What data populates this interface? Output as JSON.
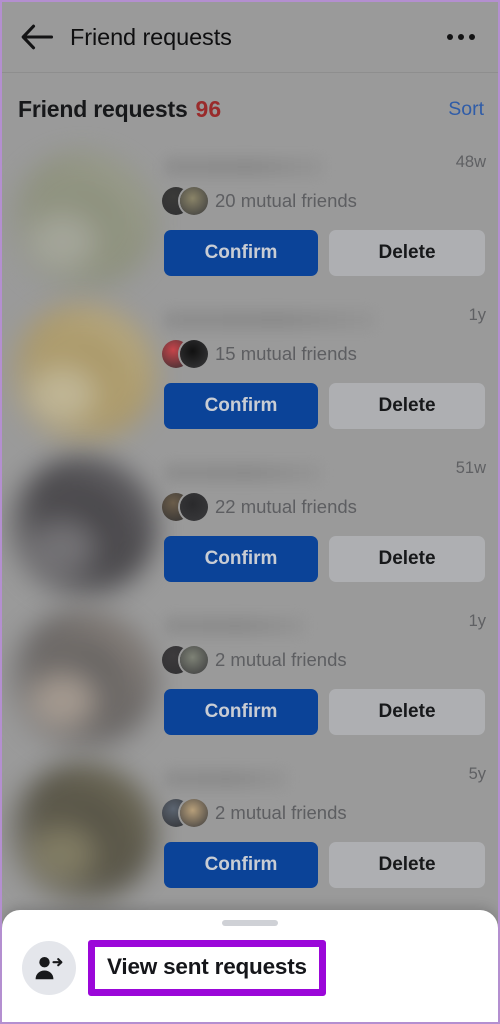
{
  "appbar": {
    "back_icon": "arrow-left-icon",
    "title": "Friend requests",
    "overflow_icon": "more-horizontal-icon"
  },
  "section": {
    "title": "Friend requests",
    "count": "96",
    "count_color": "#992b2b",
    "sort_label": "Sort",
    "sort_color": "#2f5ca8"
  },
  "colors": {
    "scrim": "#9a9a9a",
    "confirm_button": "#0b4398",
    "delete_button": "#aeafb2",
    "highlight": "#9b07d9",
    "sheet_background": "#ffffff",
    "icon_circle": "#e4e6eb",
    "frame_border": "#b48fd0"
  },
  "requests": [
    {
      "name": "",
      "name_blurred": true,
      "name_blur_width": 160,
      "age": "48w",
      "mutual": "20 mutual friends",
      "mutual_count": 20,
      "confirm_label": "Confirm",
      "delete_label": "Delete",
      "avatar_blurred": true,
      "avatar_tone_a": "#8c9078",
      "avatar_tone_b": "#a6a89a",
      "mutual_avatar_a": "#3a3a38",
      "mutual_avatar_b": "#8a8468"
    },
    {
      "name": "",
      "name_blurred": true,
      "name_blur_width": 212,
      "age": "1y",
      "mutual": "15 mutual friends",
      "mutual_count": 15,
      "confirm_label": "Confirm",
      "delete_label": "Delete",
      "avatar_blurred": true,
      "avatar_tone_a": "#b09a60",
      "avatar_tone_b": "#c8bc95",
      "mutual_avatar_a": "#c6444a",
      "mutual_avatar_b": "#111111"
    },
    {
      "name": "",
      "name_blurred": true,
      "name_blur_width": 158,
      "age": "51w",
      "mutual": "22 mutual friends",
      "mutual_count": 22,
      "confirm_label": "Confirm",
      "delete_label": "Delete",
      "avatar_blurred": true,
      "avatar_tone_a": "#38363a",
      "avatar_tone_b": "#6c6a6e",
      "mutual_avatar_a": "#6b5d4a",
      "mutual_avatar_b": "#2a2a2c"
    },
    {
      "name": "",
      "name_blurred": true,
      "name_blur_width": 142,
      "age": "1y",
      "mutual": "2 mutual friends",
      "mutual_count": 2,
      "confirm_label": "Confirm",
      "delete_label": "Delete",
      "avatar_blurred": true,
      "avatar_tone_a": "#5e5a58",
      "avatar_tone_b": "#a79a8e",
      "mutual_avatar_a": "#3c3a3c",
      "mutual_avatar_b": "#7e8276"
    },
    {
      "name": "",
      "name_blurred": true,
      "name_blur_width": 124,
      "age": "5y",
      "mutual": "2 mutual friends",
      "mutual_count": 2,
      "confirm_label": "Confirm",
      "delete_label": "Delete",
      "avatar_blurred": true,
      "avatar_tone_a": "#4a4636",
      "avatar_tone_b": "#7c7658",
      "mutual_avatar_a": "#5b6470",
      "mutual_avatar_b": "#b79f7a"
    }
  ],
  "sheet": {
    "handle": "drag-handle",
    "sent_requests": {
      "icon": "person-arrow-right-icon",
      "label": "View sent requests",
      "highlighted": true
    }
  }
}
